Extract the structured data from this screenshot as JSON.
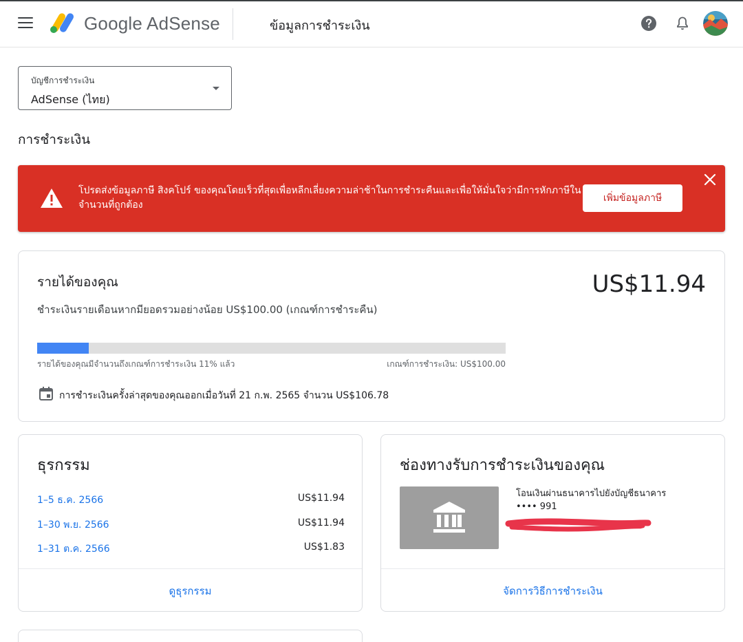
{
  "header": {
    "product_name": "Google AdSense",
    "page_title": "ข้อมูลการชำระเงิน"
  },
  "account_select": {
    "label": "บัญชีการชำระเงิน",
    "value": "AdSense (ไทย)"
  },
  "section_title": "การชำระเงิน",
  "alert": {
    "message": "โปรดส่งข้อมูลภาษี สิงคโปร์ ของคุณโดยเร็วที่สุดเพื่อหลีกเลี่ยงความล่าช้าในการชำระคืนและเพื่อให้มั่นใจว่ามีการหักภาษีในจำนวนที่ถูกต้อง",
    "button_label": "เพิ่มข้อมูลภาษี",
    "color": "#d93025"
  },
  "earnings": {
    "title": "รายได้ของคุณ",
    "amount": "US$11.94",
    "description": "ชำระเงินรายเดือนหากมียอดรวมอย่างน้อย US$100.00 (เกณฑ์การชำระคืน)",
    "progress_fraction": 0.11,
    "progress_left_label": "รายได้ของคุณมีจำนวนถึงเกณฑ์การชำระเงิน 11% แล้ว",
    "progress_right_label": "เกณฑ์การชำระเงิน: US$100.00",
    "last_payment": "การชำระเงินครั้งล่าสุดของคุณออกเมื่อวันที่ 21 ก.พ. 2565 จำนวน US$106.78",
    "accent_color": "#4285f4"
  },
  "transactions": {
    "title": "ธุรกรรม",
    "rows": [
      {
        "date": "1–5 ธ.ค. 2566",
        "amount": "US$11.94"
      },
      {
        "date": "1–30 พ.ย. 2566",
        "amount": "US$11.94"
      },
      {
        "date": "1–31 ต.ค. 2566",
        "amount": "US$1.83"
      }
    ],
    "link_label": "ดูธุรกรรม"
  },
  "payment_method": {
    "title": "ช่องทางรับการชำระเงินของคุณ",
    "description": "โอนเงินผ่านธนาคารไปยังบัญชีธนาคาร •••• 991",
    "icon": "bank-icon",
    "link_label": "จัดการวิธีการชำระเงิน"
  }
}
